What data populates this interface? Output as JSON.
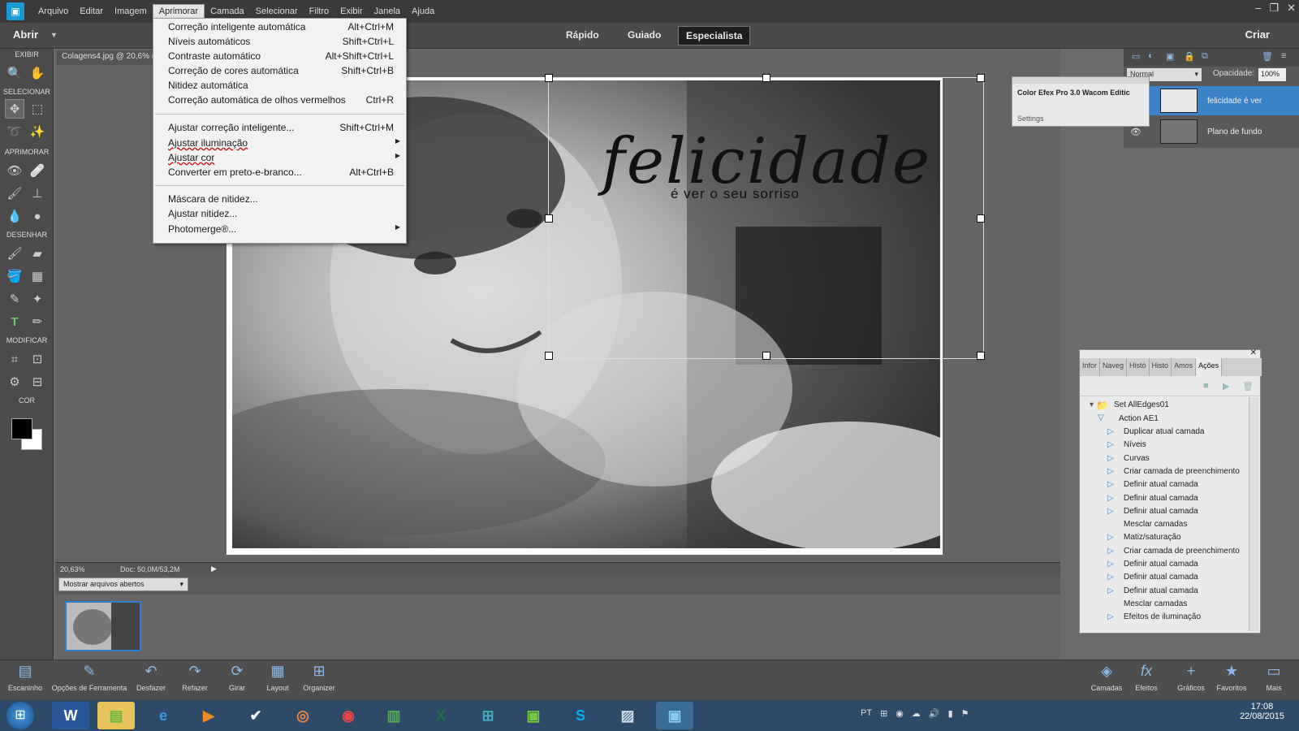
{
  "menubar": {
    "items": [
      "Arquivo",
      "Editar",
      "Imagem",
      "Aprimorar",
      "Camada",
      "Selecionar",
      "Filtro",
      "Exibir",
      "Janela",
      "Ajuda"
    ],
    "active_index": 3
  },
  "toolbar_top": {
    "open": "Abrir",
    "modes": [
      "Rápido",
      "Guiado",
      "Especialista"
    ],
    "active_mode": "Especialista",
    "create": "Criar"
  },
  "tools_sections": {
    "view": "EXIBIR",
    "select": "SELECIONAR",
    "enhance": "APRIMORAR",
    "draw": "DESENHAR",
    "modify": "MODIFICAR",
    "color": "COR"
  },
  "document": {
    "tab": "Colagens4.jpg @ 20,6% (fe",
    "overlay_title": "felicidade",
    "overlay_subtitle": "é ver o seu sorriso",
    "zoom": "20,63%",
    "doc_size": "Doc: 50,0M/53,2M"
  },
  "bin": {
    "selector": "Mostrar arquivos abertos"
  },
  "enhance_menu": {
    "group1": [
      {
        "label": "Correção inteligente automática",
        "shortcut": "Alt+Ctrl+M"
      },
      {
        "label": "Níveis automáticos",
        "shortcut": "Shift+Ctrl+L"
      },
      {
        "label": "Contraste automático",
        "shortcut": "Alt+Shift+Ctrl+L"
      },
      {
        "label": "Correção de cores automática",
        "shortcut": "Shift+Ctrl+B"
      },
      {
        "label": "Nitidez automática",
        "shortcut": ""
      },
      {
        "label": "Correção automática de olhos vermelhos",
        "shortcut": "Ctrl+R"
      }
    ],
    "group2": [
      {
        "label": "Ajustar correção inteligente...",
        "shortcut": "Shift+Ctrl+M"
      },
      {
        "label": "Ajustar iluminação",
        "shortcut": ""
      },
      {
        "label": "Ajustar cor",
        "shortcut": ""
      },
      {
        "label": "Converter em preto-e-branco...",
        "shortcut": "Alt+Ctrl+B"
      }
    ],
    "group3": [
      {
        "label": "Máscara de nitidez...",
        "shortcut": ""
      },
      {
        "label": "Ajustar nitidez...",
        "shortcut": ""
      },
      {
        "label": "Photomerge®...",
        "shortcut": ""
      }
    ]
  },
  "layers": {
    "blend_mode": "Normal",
    "opacity_label": "Opacidade:",
    "opacity_value": "100%",
    "items": [
      {
        "name": "felicidade é ver",
        "selected": true
      },
      {
        "name": "Plano de fundo",
        "selected": false
      }
    ]
  },
  "color_efex": {
    "title": "Color Efex Pro 3.0 Wacom Editic",
    "settings": "Settings"
  },
  "actions_panel": {
    "tabs": [
      "Infor",
      "Naveg",
      "Histó",
      "Histo",
      "Amos",
      "Ações"
    ],
    "active_tab": "Ações",
    "set_name": "Set AllEdges01",
    "action_name": "Action AE1",
    "steps": [
      {
        "label": "Duplicar atual camada",
        "expandable": true
      },
      {
        "label": "Níveis",
        "expandable": true
      },
      {
        "label": "Curvas",
        "expandable": true
      },
      {
        "label": "Criar camada de preenchimento",
        "expandable": true
      },
      {
        "label": "Definir atual camada",
        "expandable": true
      },
      {
        "label": "Definir atual camada",
        "expandable": true
      },
      {
        "label": "Definir atual camada",
        "expandable": true
      },
      {
        "label": "Mesclar camadas",
        "expandable": false
      },
      {
        "label": "Matiz/saturação",
        "expandable": true
      },
      {
        "label": "Criar camada de preenchimento",
        "expandable": true
      },
      {
        "label": "Definir atual camada",
        "expandable": true
      },
      {
        "label": "Definir atual camada",
        "expandable": true
      },
      {
        "label": "Definir atual camada",
        "expandable": true
      },
      {
        "label": "Mesclar camadas",
        "expandable": false
      },
      {
        "label": "Efeitos de iluminação",
        "expandable": true
      }
    ]
  },
  "bottom_bar": {
    "left": [
      "Escaninho",
      "Opções de Ferramenta",
      "Desfazer",
      "Refazer",
      "Girar",
      "Layout",
      "Organizer"
    ],
    "right": [
      "Camadas",
      "Efeitos",
      "Gráficos",
      "Favoritos",
      "Mais"
    ]
  },
  "taskbar": {
    "language": "PT",
    "time": "17:08",
    "date": "22/08/2015"
  }
}
